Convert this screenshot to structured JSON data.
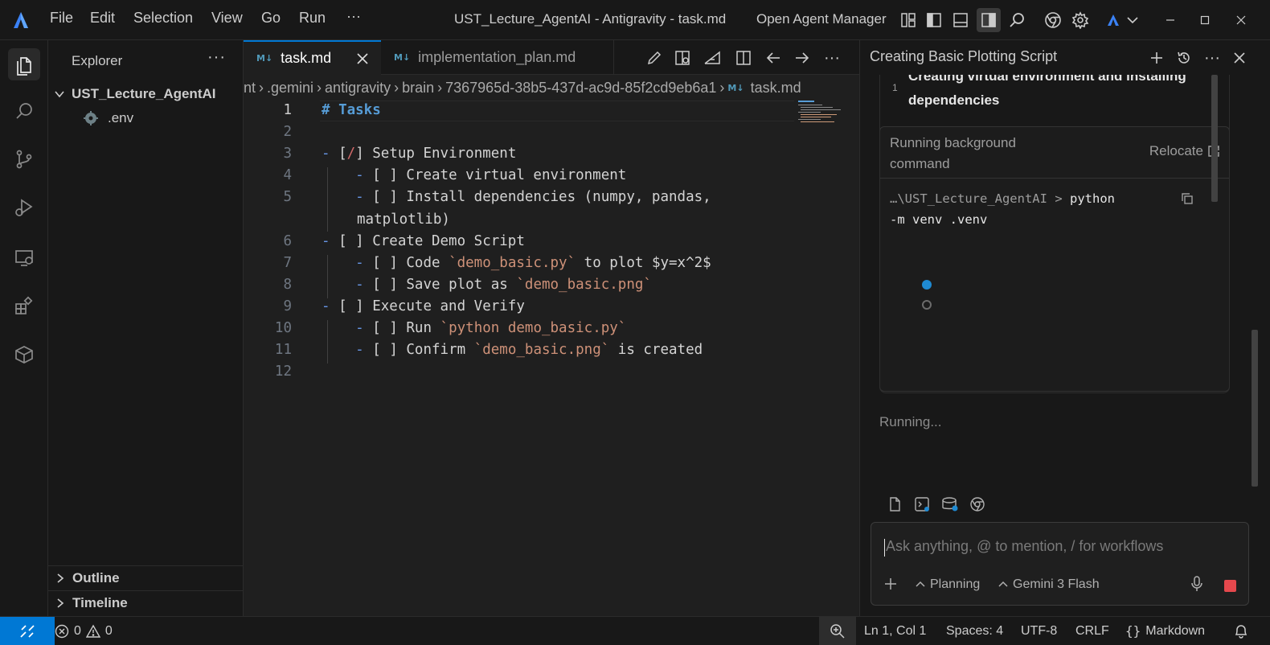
{
  "menu": [
    "File",
    "Edit",
    "Selection",
    "View",
    "Go",
    "Run",
    "···"
  ],
  "window_title": "UST_Lecture_AgentAI - Antigravity - task.md",
  "agent_manager_label": "Open Agent Manager",
  "sidebar": {
    "title": "Explorer",
    "more": "···",
    "folder": "UST_Lecture_AgentAI",
    "files": [
      ".env"
    ],
    "panels": [
      "Outline",
      "Timeline"
    ]
  },
  "editor": {
    "tabs": [
      {
        "icon": "M↓",
        "label": "task.md",
        "active": true
      },
      {
        "icon": "M↓",
        "label": "implementation_plan.md",
        "active": false
      }
    ],
    "breadcrumb": {
      "segments": [
        "nt",
        ".gemini",
        "antigravity",
        "brain",
        "7367965d-38b5-437d-ac9d-85f2cd9eb6a1"
      ],
      "file_icon": "M↓",
      "file": "task.md"
    },
    "line_numbers": [
      "1",
      "2",
      "3",
      "4",
      "5",
      "",
      "6",
      "7",
      "8",
      "9",
      "10",
      "11",
      "12"
    ],
    "code": {
      "l1": "# Tasks",
      "l3_a": "[",
      "l3_b": "/",
      "l3_c": "] Setup Environment",
      "l4": "[ ] Create virtual environment",
      "l5": "[ ] Install dependencies (numpy, pandas,",
      "l5b": "matplotlib)",
      "l6": "[ ] Create Demo Script",
      "l7_a": "[ ] Code ",
      "l7_b": "`demo_basic.py`",
      "l7_c": " to plot $y=x^2$",
      "l8_a": "[ ] Save plot as ",
      "l8_b": "`demo_basic.png`",
      "l9": "[ ] Execute and Verify",
      "l10_a": "[ ] Run ",
      "l10_b": "`python demo_basic.py`",
      "l11_a": "[ ] Confirm ",
      "l11_b": "`demo_basic.png`",
      "l11_c": " is created",
      "bullet": "-"
    }
  },
  "agent": {
    "title": "Creating Basic Plotting Script",
    "step_number": "1",
    "step_title": "Creating virtual environment and installing dependencies",
    "command_box": {
      "label": "Running background command",
      "relocate": "Relocate",
      "path": "…\\UST_Lecture_AgentAI",
      "prompt": ">",
      "cmd_a": "python",
      "cmd_b": "-m venv .venv"
    },
    "status": "Running...",
    "input_placeholder": "Ask anything, @ to mention, / for workflows",
    "mode": "Planning",
    "model": "Gemini 3 Flash",
    "colors": {
      "stop": "#e5484d",
      "progress_dot": "#1f8ad2"
    }
  },
  "status_bar": {
    "errors": "0",
    "warnings": "0",
    "position": "Ln 1, Col 1",
    "spaces": "Spaces: 4",
    "encoding": "UTF-8",
    "eol": "CRLF",
    "language_icon": "{}",
    "language": "Markdown",
    "remote_color": "#0078d4"
  }
}
